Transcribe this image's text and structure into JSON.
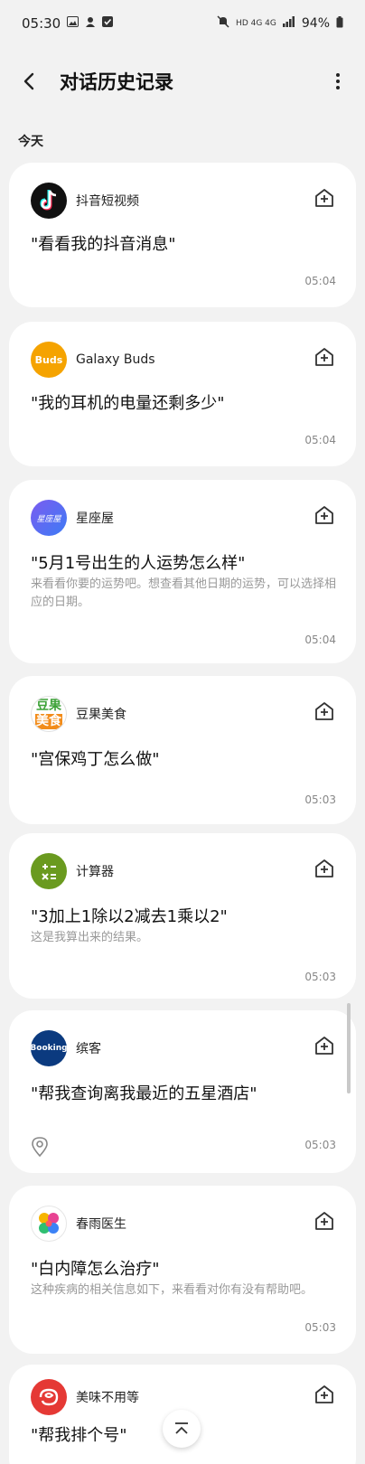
{
  "status_bar": {
    "time": "05:30",
    "left_icons": [
      "image-icon",
      "notification-icon",
      "check-icon"
    ],
    "network": "HD 4G 4G",
    "battery": "94%"
  },
  "header": {
    "title": "对话历史记录"
  },
  "section": {
    "label": "今天"
  },
  "cards": [
    {
      "app_name": "抖音短视频",
      "icon": "tiktok-icon",
      "icon_color": "#111111",
      "query": "\"看看我的抖音消息\"",
      "reply": "",
      "time": "05:04"
    },
    {
      "app_name": "Galaxy Buds",
      "icon": "buds-icon",
      "icon_text": "Buds",
      "icon_color": "#f5a300",
      "query": "\"我的耳机的电量还剩多少\"",
      "reply": "",
      "time": "05:04"
    },
    {
      "app_name": "星座屋",
      "icon": "xingzuowu-icon",
      "icon_text": "星座屋",
      "icon_color": "#6a4de0",
      "query": "\"5月1号出生的人运势怎么样\"",
      "reply": "来看看你要的运势吧。想查看其他日期的运势，可以选择相应的日期。",
      "time": "05:04"
    },
    {
      "app_name": "豆果美食",
      "icon": "douguo-icon",
      "icon_text_top": "豆果",
      "icon_text_bottom": "美食",
      "icon_color": "#3fa33a",
      "query": "\"宫保鸡丁怎么做\"",
      "reply": "",
      "time": "05:03"
    },
    {
      "app_name": "计算器",
      "icon": "calculator-icon",
      "icon_color": "#6a9a1f",
      "query": "\"3加上1除以2减去1乘以2\"",
      "reply": "这是我算出来的结果。",
      "time": "05:03"
    },
    {
      "app_name": "缤客",
      "icon": "booking-icon",
      "icon_text": "Booking",
      "icon_color": "#0b3a7f",
      "query": "\"帮我查询离我最近的五星酒店\"",
      "reply": "",
      "time": "05:03"
    },
    {
      "app_name": "春雨医生",
      "icon": "chunyu-icon",
      "icon_color": "#ffffff",
      "query": "\"白内障怎么治疗\"",
      "reply": "这种疾病的相关信息如下，来看看对你有没有帮助吧。",
      "time": "05:03"
    },
    {
      "app_name": "美味不用等",
      "icon": "meiwei-icon",
      "icon_color": "#e53935",
      "query": "\"帮我排个号\"",
      "reply": "",
      "time": ""
    }
  ]
}
